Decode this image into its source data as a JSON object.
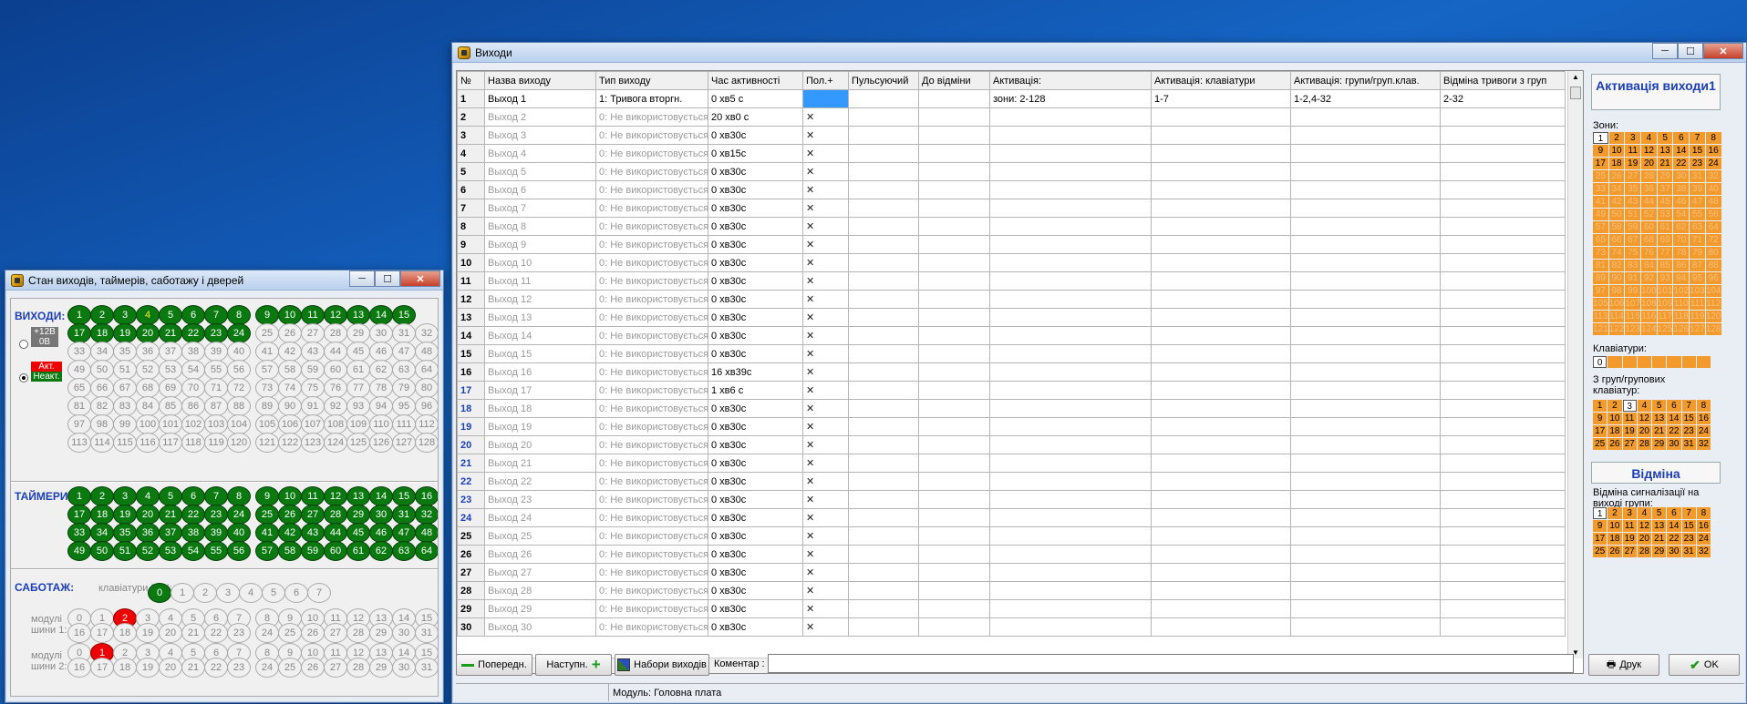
{
  "main": {
    "title": "Виходи",
    "columns": [
      "№",
      "Назва виходу",
      "Тип виходу",
      "Час активності",
      "Пол.+",
      "Пульсуючий",
      "До відміни",
      "Активація:",
      "Активація: клавіатури",
      "Активація: групи/груп.клав.",
      "Відміна тривоги з груп"
    ],
    "rows": [
      {
        "n": "1",
        "name": "Выход   1",
        "type": "1: Тривога вторгн.",
        "time": "0  хв5 с",
        "pol": "",
        "act": "зони: 2-128",
        "kbd": "1-7",
        "grp": "1-2,4-32",
        "cancel": "2-32"
      },
      {
        "n": "2",
        "name": "Выход   2",
        "type": "0: Не використовується",
        "time": "20 хв0 с",
        "pol": "✕"
      },
      {
        "n": "3",
        "name": "Выход   3",
        "type": "0: Не використовується",
        "time": "0  хв30с",
        "pol": "✕"
      },
      {
        "n": "4",
        "name": "Выход   4",
        "type": "0: Не використовується",
        "time": "0  хв15с",
        "pol": "✕"
      },
      {
        "n": "5",
        "name": "Выход   5",
        "type": "0: Не використовується",
        "time": "0  хв30с",
        "pol": "✕"
      },
      {
        "n": "6",
        "name": "Выход   6",
        "type": "0: Не використовується",
        "time": "0  хв30с",
        "pol": "✕"
      },
      {
        "n": "7",
        "name": "Выход   7",
        "type": "0: Не використовується",
        "time": "0  хв30с",
        "pol": "✕"
      },
      {
        "n": "8",
        "name": "Выход   8",
        "type": "0: Не використовується",
        "time": "0  хв30с",
        "pol": "✕"
      },
      {
        "n": "9",
        "name": "Выход   9",
        "type": "0: Не використовується",
        "time": "0  хв30с",
        "pol": "✕"
      },
      {
        "n": "10",
        "name": "Выход  10",
        "type": "0: Не використовується",
        "time": "0  хв30с",
        "pol": "✕"
      },
      {
        "n": "11",
        "name": "Выход  11",
        "type": "0: Не використовується",
        "time": "0  хв30с",
        "pol": "✕"
      },
      {
        "n": "12",
        "name": "Выход  12",
        "type": "0: Не використовується",
        "time": "0  хв30с",
        "pol": "✕"
      },
      {
        "n": "13",
        "name": "Выход  13",
        "type": "0: Не використовується",
        "time": "0  хв30с",
        "pol": "✕"
      },
      {
        "n": "14",
        "name": "Выход  14",
        "type": "0: Не використовується",
        "time": "0  хв30с",
        "pol": "✕"
      },
      {
        "n": "15",
        "name": "Выход  15",
        "type": "0: Не використовується",
        "time": "0  хв30с",
        "pol": "✕"
      },
      {
        "n": "16",
        "name": "Выход  16",
        "type": "0: Не використовується",
        "time": "16 хв39с",
        "pol": "✕"
      },
      {
        "n": "17",
        "name": "Выход  17",
        "type": "0: Не використовується",
        "time": "1  хв6 с",
        "pol": "✕",
        "blue": true
      },
      {
        "n": "18",
        "name": "Выход  18",
        "type": "0: Не використовується",
        "time": "0  хв30с",
        "pol": "✕",
        "blue": true
      },
      {
        "n": "19",
        "name": "Выход  19",
        "type": "0: Не використовується",
        "time": "0  хв30с",
        "pol": "✕",
        "blue": true
      },
      {
        "n": "20",
        "name": "Выход  20",
        "type": "0: Не використовується",
        "time": "0  хв30с",
        "pol": "✕",
        "blue": true
      },
      {
        "n": "21",
        "name": "Выход  21",
        "type": "0: Не використовується",
        "time": "0  хв30с",
        "pol": "✕",
        "blue": true
      },
      {
        "n": "22",
        "name": "Выход  22",
        "type": "0: Не використовується",
        "time": "0  хв30с",
        "pol": "✕",
        "blue": true
      },
      {
        "n": "23",
        "name": "Выход  23",
        "type": "0: Не використовується",
        "time": "0  хв30с",
        "pol": "✕",
        "blue": true
      },
      {
        "n": "24",
        "name": "Выход  24",
        "type": "0: Не використовується",
        "time": "0  хв30с",
        "pol": "✕",
        "blue": true
      },
      {
        "n": "25",
        "name": "Выход  25",
        "type": "0: Не використовується",
        "time": "0  хв30с",
        "pol": "✕"
      },
      {
        "n": "26",
        "name": "Выход  26",
        "type": "0: Не використовується",
        "time": "0  хв30с",
        "pol": "✕"
      },
      {
        "n": "27",
        "name": "Выход  27",
        "type": "0: Не використовується",
        "time": "0  хв30с",
        "pol": "✕"
      },
      {
        "n": "28",
        "name": "Выход  28",
        "type": "0: Не використовується",
        "time": "0  хв30с",
        "pol": "✕"
      },
      {
        "n": "29",
        "name": "Выход  29",
        "type": "0: Не використовується",
        "time": "0  хв30с",
        "pol": "✕"
      },
      {
        "n": "30",
        "name": "Выход  30",
        "type": "0: Не використовується",
        "time": "0  хв30с",
        "pol": "✕"
      }
    ],
    "side": {
      "activation_title": "Активація виходи1",
      "zones_label": "Зони:",
      "keyboards_label": "Клавіатури:",
      "groups_label": "З груп/групових клавіатур:",
      "cancel_title": "Відміна",
      "cancel_label": "Відміна сигналізації на виході групи:"
    },
    "buttons": {
      "prev": "Попередн.",
      "next": "Наступн.",
      "sets": "Набори виходів",
      "comment_label": "Коментар :",
      "print": "Друк",
      "ok": "OK"
    },
    "status": "Модуль: Головна плата"
  },
  "small": {
    "title": "Стан виходів, таймерів, саботажу і дверей",
    "outputs_label": "ВИХОДИ:",
    "legend_12v": "+12В",
    "legend_0v": "0В",
    "legend_act": "Акт.",
    "legend_inact": "Неакт.",
    "timers_label": "ТАЙМЕРИ:",
    "sabotage_label": "САБОТАЖ:",
    "rkk_label": "клавіатури РКК:",
    "bus1_label": "модулі шини 1:",
    "bus2_label": "модулі шини 2:"
  },
  "colors": {
    "orange": "#f39a2d",
    "green": "#0a7a10",
    "red": "#e00000",
    "blue": "#1c3fb5"
  }
}
